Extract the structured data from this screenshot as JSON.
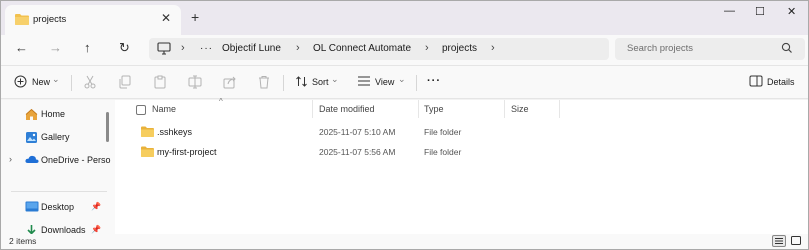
{
  "tab": {
    "title": "projects",
    "close": "✕",
    "new_tab": "+"
  },
  "window_controls": {
    "minimize": "—",
    "maximize": "☐",
    "close": "✕"
  },
  "nav": {
    "back": "←",
    "forward": "→",
    "up": "↑",
    "refresh": "↻"
  },
  "address": {
    "more": "···",
    "sep": "›",
    "crumbs": [
      "Objectif Lune",
      "OL Connect Automate",
      "projects"
    ]
  },
  "search": {
    "placeholder": "Search projects"
  },
  "toolbar": {
    "new_label": "New",
    "sort_label": "Sort",
    "view_label": "View",
    "more_label": "···",
    "details_label": "Details",
    "caret": "⌄"
  },
  "sidebar": {
    "items": [
      {
        "label": "Home",
        "icon": "home-icon"
      },
      {
        "label": "Gallery",
        "icon": "gallery-icon"
      },
      {
        "label": "OneDrive - Perso",
        "icon": "onedrive-icon"
      },
      {
        "label": "Desktop",
        "icon": "desktop-icon"
      },
      {
        "label": "Downloads",
        "icon": "downloads-icon"
      }
    ],
    "expand": "›",
    "pin": "📌"
  },
  "columns": {
    "name": "Name",
    "date_modified": "Date modified",
    "type": "Type",
    "size": "Size",
    "sort_indicator": "^"
  },
  "files": [
    {
      "name": ".sshkeys",
      "date": "2025-11-07 5:10 AM",
      "type": "File folder"
    },
    {
      "name": "my-first-project",
      "date": "2025-11-07 5:56 AM",
      "type": "File folder"
    }
  ],
  "status": {
    "item_count": "2 items"
  },
  "colors": {
    "folder": "#f2c14e",
    "accent": "#0067c0",
    "titlebar": "#ebe8ef"
  }
}
